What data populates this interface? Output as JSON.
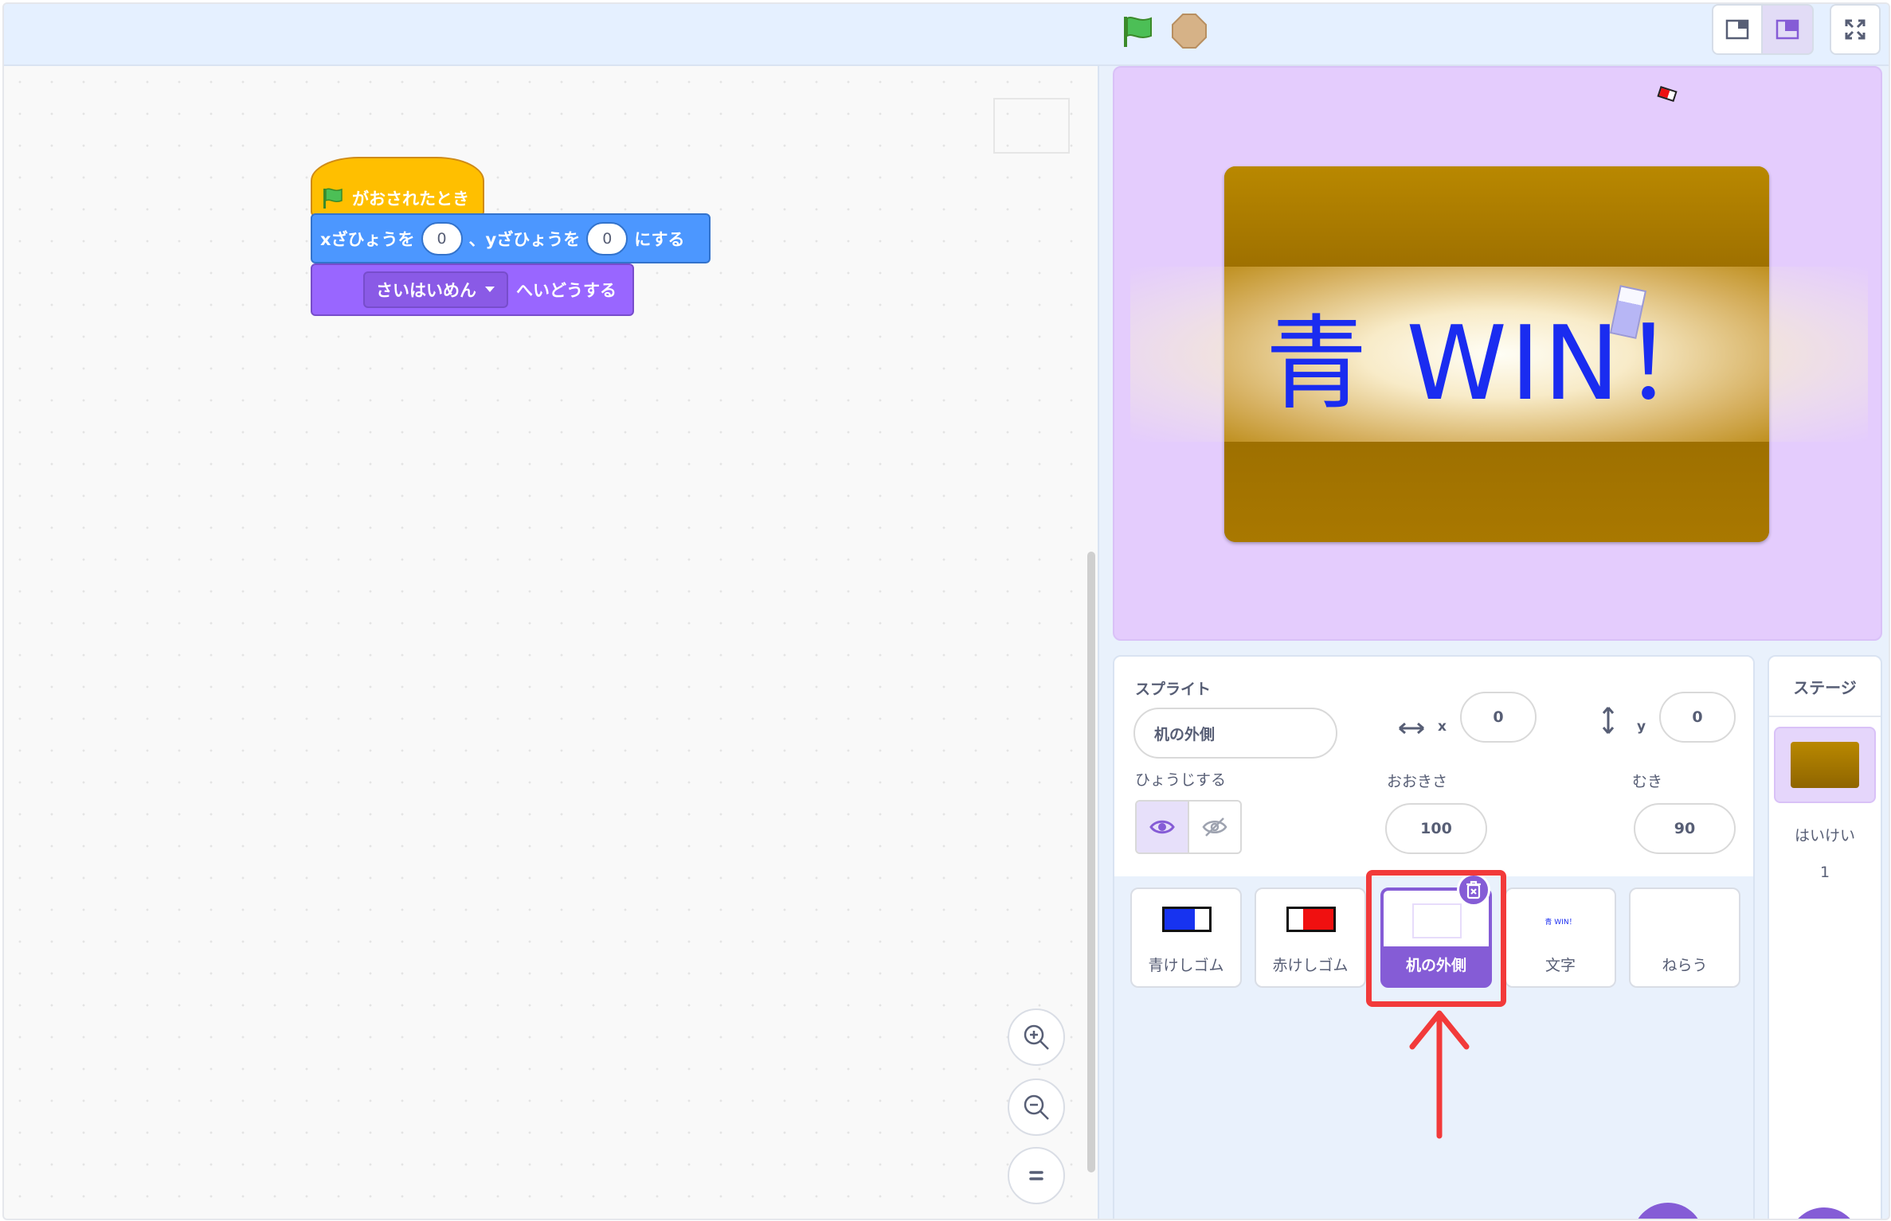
{
  "toolbar": {
    "green_flag_icon": "green-flag",
    "stop_icon": "stop-sign",
    "layout_modes": [
      "small-stage",
      "normal-stage"
    ],
    "fullscreen_icon": "fullscreen"
  },
  "script": {
    "hat_label": "がおされたとき",
    "motion_x_label": "xざひょうを",
    "motion_x_value": "0",
    "motion_sep": "、yざひょうを",
    "motion_y_value": "0",
    "motion_tail": "にする",
    "looks_dropdown": "さいはいめん",
    "looks_tail": "へいどうする"
  },
  "stage": {
    "banner_text": "青 WIN！",
    "colors": {
      "stage_bg": "#e4ccfd",
      "board": "#a97900",
      "text": "#1a2cf0"
    }
  },
  "sprite_info": {
    "section_label": "スプライト",
    "name_value": "机の外側",
    "x_label": "x",
    "x_value": "0",
    "y_label": "y",
    "y_value": "0",
    "show_label": "ひょうじする",
    "size_label": "おおきさ",
    "size_value": "100",
    "direction_label": "むき",
    "direction_value": "90"
  },
  "sprites": [
    {
      "name": "青けしゴム"
    },
    {
      "name": "赤けしゴム"
    },
    {
      "name": "机の外側",
      "selected": true
    },
    {
      "name": "文字",
      "thumb_text": "青 WIN！"
    },
    {
      "name": "ねらう"
    }
  ],
  "stage_panel": {
    "title": "ステージ",
    "backdrops_label": "はいけい",
    "backdrops_count": "1"
  },
  "annotation": {
    "color": "#f23a3a"
  }
}
